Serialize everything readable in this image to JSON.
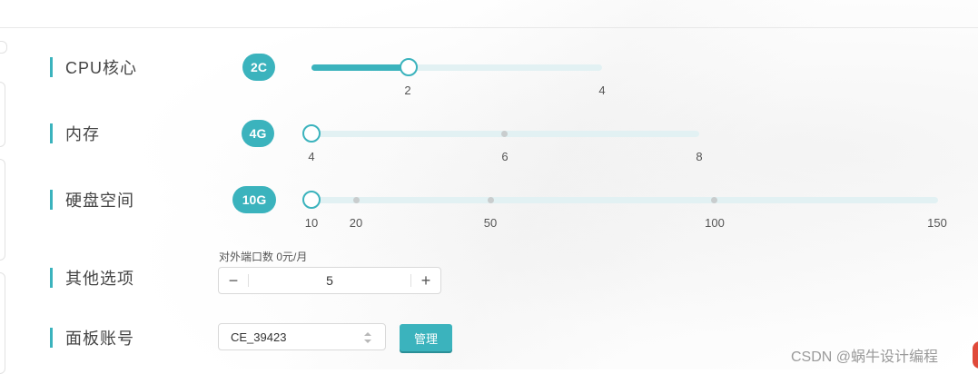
{
  "rows": {
    "cpu": {
      "label": "CPU核心",
      "badge": "2C",
      "ticks": [
        "2",
        "4"
      ],
      "slider": {
        "min": 1,
        "max": 4,
        "value": 2
      }
    },
    "memory": {
      "label": "内存",
      "badge": "4G",
      "ticks": [
        "4",
        "6",
        "8"
      ],
      "slider": {
        "min": 4,
        "max": 8,
        "value": 4
      }
    },
    "disk": {
      "label": "硬盘空间",
      "badge": "10G",
      "ticks": [
        "10",
        "20",
        "50",
        "100",
        "150"
      ],
      "slider": {
        "min": 10,
        "max": 150,
        "value": 10
      }
    },
    "other": {
      "label": "其他选项",
      "ports_label": "对外端口数 0元/月",
      "ports_value": "5",
      "minus": "−",
      "plus": "+"
    },
    "panel": {
      "label": "面板账号",
      "account": "CE_39423",
      "manage_label": "管理"
    }
  },
  "watermark": "CSDN @蜗牛设计编程",
  "colors": {
    "accent": "#3bb3bd",
    "track": "#e2f1f3"
  }
}
